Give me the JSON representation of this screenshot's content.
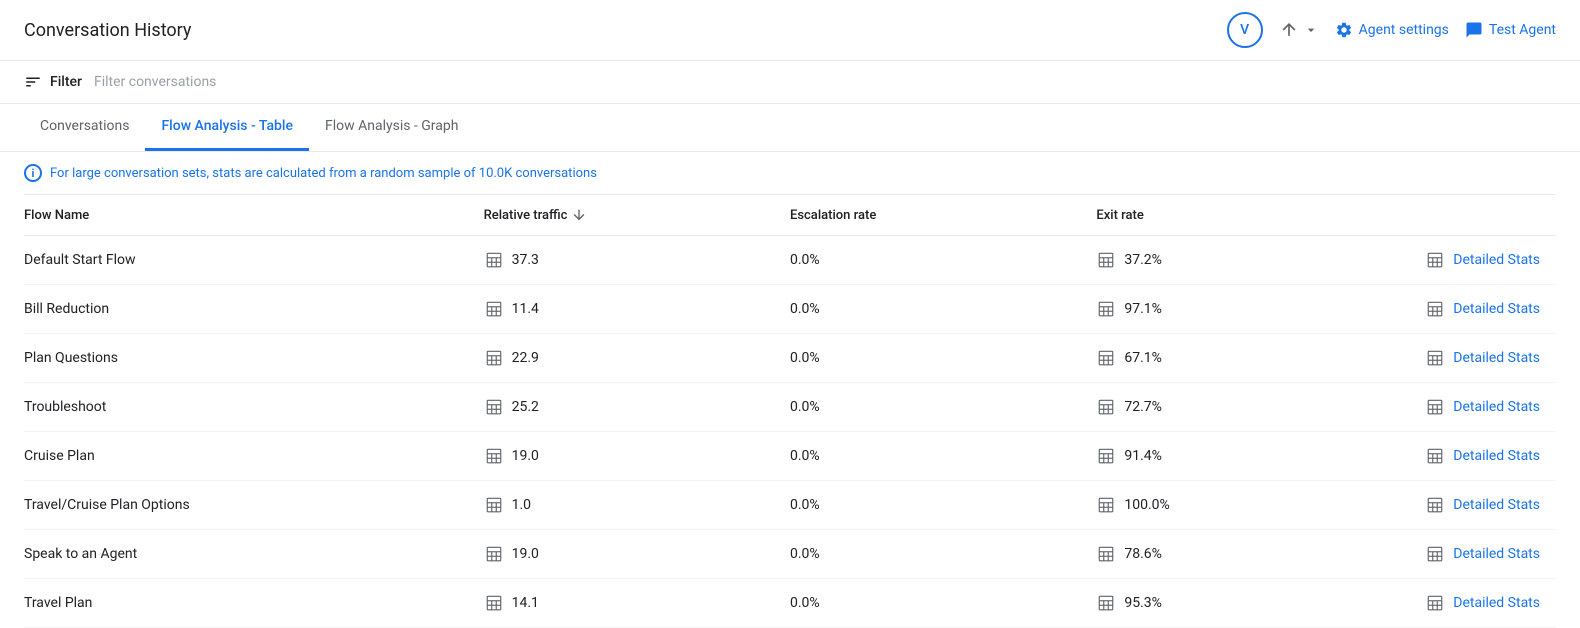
{
  "header": {
    "title": "Conversation History",
    "avatar": "V",
    "sort_label": "",
    "agent_settings_label": "Agent settings",
    "test_agent_label": "Test Agent"
  },
  "filter": {
    "label": "Filter",
    "placeholder": "Filter conversations"
  },
  "tabs": [
    {
      "id": "conversations",
      "label": "Conversations",
      "active": false
    },
    {
      "id": "flow-analysis-table",
      "label": "Flow Analysis - Table",
      "active": true
    },
    {
      "id": "flow-analysis-graph",
      "label": "Flow Analysis - Graph",
      "active": false
    }
  ],
  "info_banner": "For large conversation sets, stats are calculated from a random sample of 10.0K conversations",
  "table": {
    "columns": [
      {
        "id": "flow_name",
        "label": "Flow Name",
        "sortable": false
      },
      {
        "id": "relative_traffic",
        "label": "Relative traffic",
        "sortable": true
      },
      {
        "id": "escalation_rate",
        "label": "Escalation rate",
        "sortable": false
      },
      {
        "id": "exit_rate",
        "label": "Exit rate",
        "sortable": false
      }
    ],
    "rows": [
      {
        "flow_name": "Default Start Flow",
        "relative_traffic": "37.3",
        "escalation_rate": "0.0%",
        "exit_rate": "37.2%",
        "detailed_stats": "Detailed Stats"
      },
      {
        "flow_name": "Bill Reduction",
        "relative_traffic": "11.4",
        "escalation_rate": "0.0%",
        "exit_rate": "97.1%",
        "detailed_stats": "Detailed Stats"
      },
      {
        "flow_name": "Plan Questions",
        "relative_traffic": "22.9",
        "escalation_rate": "0.0%",
        "exit_rate": "67.1%",
        "detailed_stats": "Detailed Stats"
      },
      {
        "flow_name": "Troubleshoot",
        "relative_traffic": "25.2",
        "escalation_rate": "0.0%",
        "exit_rate": "72.7%",
        "detailed_stats": "Detailed Stats"
      },
      {
        "flow_name": "Cruise Plan",
        "relative_traffic": "19.0",
        "escalation_rate": "0.0%",
        "exit_rate": "91.4%",
        "detailed_stats": "Detailed Stats"
      },
      {
        "flow_name": "Travel/Cruise Plan Options",
        "relative_traffic": "1.0",
        "escalation_rate": "0.0%",
        "exit_rate": "100.0%",
        "detailed_stats": "Detailed Stats"
      },
      {
        "flow_name": "Speak to an Agent",
        "relative_traffic": "19.0",
        "escalation_rate": "0.0%",
        "exit_rate": "78.6%",
        "detailed_stats": "Detailed Stats"
      },
      {
        "flow_name": "Travel Plan",
        "relative_traffic": "14.1",
        "escalation_rate": "0.0%",
        "exit_rate": "95.3%",
        "detailed_stats": "Detailed Stats"
      }
    ]
  }
}
